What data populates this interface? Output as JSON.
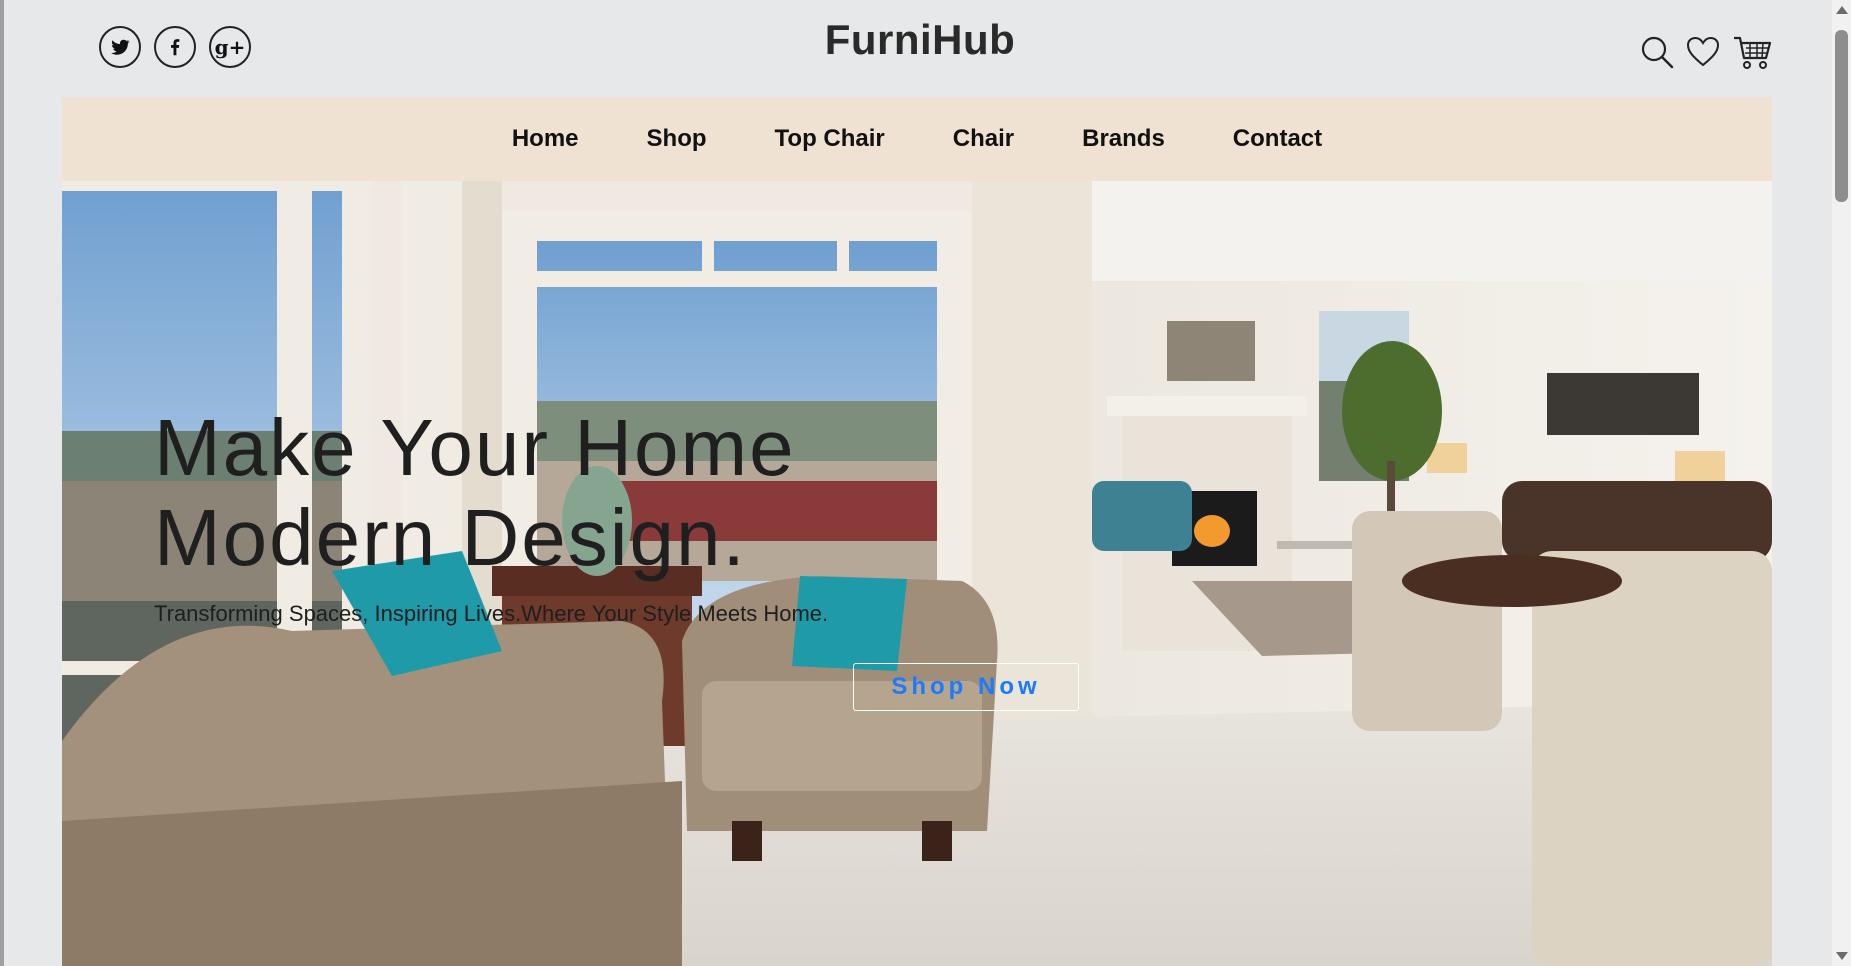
{
  "brand": {
    "logo": "FurniHub"
  },
  "social": [
    {
      "name": "twitter-icon"
    },
    {
      "name": "facebook-icon"
    },
    {
      "name": "google-plus-icon",
      "glyph": "g+"
    }
  ],
  "tools": [
    {
      "name": "search-icon"
    },
    {
      "name": "heart-icon"
    },
    {
      "name": "cart-icon"
    }
  ],
  "nav": {
    "items": [
      "Home",
      "Shop",
      "Top Chair",
      "Chair",
      "Brands",
      "Contact"
    ]
  },
  "hero": {
    "title_line1": "Make Your Home",
    "title_line2": "Modern Design.",
    "subtitle": "Transforming Spaces, Inspiring Lives.Where Your Style Meets Home.",
    "cta": "Shop Now"
  },
  "colors": {
    "nav_bg": "#f0e2d2",
    "cta_text": "#1a7bff",
    "page_bg": "#e6e8ea",
    "accent_teal": "#1f9aa8"
  }
}
